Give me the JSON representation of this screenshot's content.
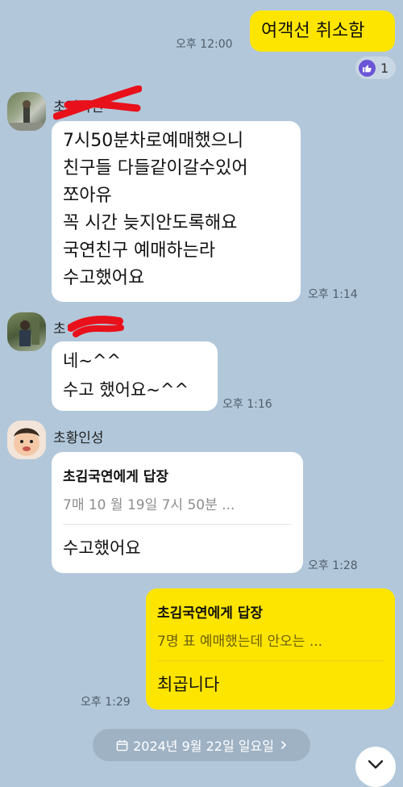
{
  "messages": {
    "m1": {
      "text": "여객선 취소함",
      "time": "오후 12:00",
      "reaction_count": "1"
    },
    "m2": {
      "sender": "초김국연",
      "text": "7시50분차로예매했으니\n친구들 다들같이갈수있어\n쪼아유\n꼭 시간 늦지안도록해요\n국연친구 예매하는라\n수고했어요",
      "time": "오후 1:14"
    },
    "m3": {
      "sender": "초",
      "text": "네~^^\n수고  했어요~^^",
      "time": "오후 1:16"
    },
    "m4": {
      "sender": "초황인성",
      "reply_title": "초김국연에게 답장",
      "reply_snippet": "7매 10 월 19일 7시 50분 ...",
      "text": "수고했어요",
      "time": "오후 1:28"
    },
    "m5": {
      "reply_title": "초김국연에게 답장",
      "reply_snippet": "7명 표 예매했는데 안오는 ...",
      "text": "최곱니다",
      "time": "오후 1:29"
    }
  },
  "date_pill": {
    "label": "2024년 9월 22일 일요일",
    "icon": "calendar-icon",
    "chevron": "chevron-right-icon"
  },
  "scroll_button": {
    "icon": "chevron-down-icon"
  },
  "colors": {
    "background": "#b2c7da",
    "my_bubble": "#fee500",
    "other_bubble": "#ffffff",
    "redaction": "#e8101a",
    "reaction_badge": "#6b55d6"
  }
}
